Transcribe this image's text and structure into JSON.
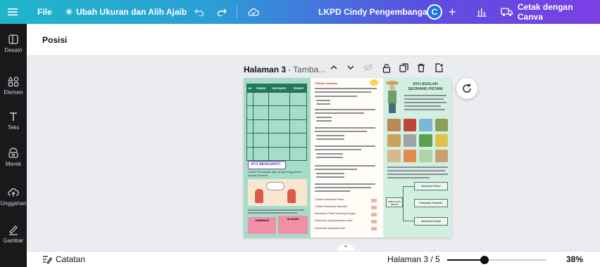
{
  "topbar": {
    "menu_icon": "hamburger-icon",
    "file": "File",
    "resize": "Ubah Ukuran dan Alih Ajaib",
    "title": "LKPD Cindy Pengembangan",
    "avatar_letter": "C",
    "print": "Cetak dengan Canva",
    "colors": {
      "avatar": "#1f6fe5"
    }
  },
  "sidebar": {
    "items": [
      {
        "label": "Desain",
        "icon": "layout-icon"
      },
      {
        "label": "Elemen",
        "icon": "shapes-icon"
      },
      {
        "label": "Teks",
        "icon": "text-icon"
      },
      {
        "label": "Merek",
        "icon": "brand-icon"
      },
      {
        "label": "Unggahan",
        "icon": "upload-icon"
      },
      {
        "label": "Gambar",
        "icon": "draw-icon"
      }
    ]
  },
  "header": {
    "title": "Posisi"
  },
  "canvas": {
    "page_label": "Halaman 3",
    "page_title_placeholder": "- Tamba...",
    "page_content": {
      "table_headers": [
        "NO",
        "PRIMER",
        "SEKUNDER",
        "TERSIER"
      ],
      "section_title": "AYO MENGAMATI",
      "instruction": "Lihatlah Percakapan Agus dengan Anggi Berikut dengan Seksama",
      "answer_left": "JAWABAN",
      "answer_right": "ALASAN",
      "right_title": "AYU ADALAH SEORANG PETANI",
      "middle_heading": "Pilihlah Jawaban",
      "middle_items": [
        "Contoh Kebutuhan Primer",
        "Contoh Kebutuhan Sekunder",
        "Kebutuhan Primer Seorang Petugas",
        "Kebutuhan yang diperlukan suatu",
        "Kebutuhan saat petani dari"
      ],
      "right_boxes": [
        "Kebutuhan Primer",
        "Kebutuhan Sekunder",
        "Kebutuhan Tersier"
      ],
      "right_center_box": "KEBUTUHAN PETANI"
    }
  },
  "bottombar": {
    "notes": "Catatan",
    "page_indicator": "Halaman 3 / 5",
    "zoom": "38%",
    "zoom_value": 0.38
  }
}
